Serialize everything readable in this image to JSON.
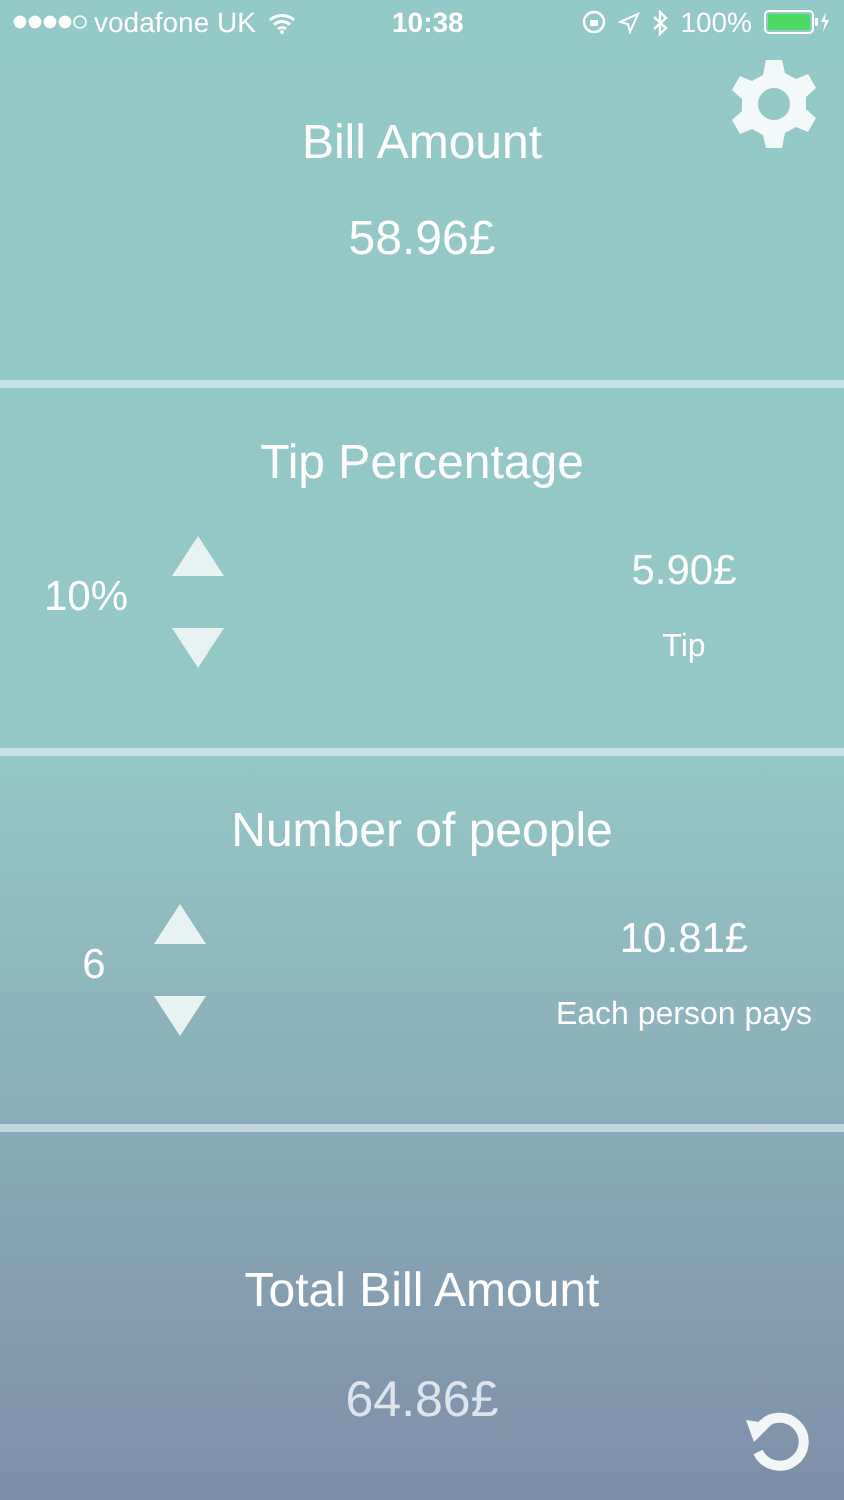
{
  "status_bar": {
    "carrier": "vodafone UK",
    "time": "10:38",
    "battery": "100%"
  },
  "bill": {
    "title": "Bill Amount",
    "amount": "58.96£"
  },
  "tip": {
    "title": "Tip Percentage",
    "percent": "10%",
    "amount": "5.90£",
    "caption": "Tip"
  },
  "people": {
    "title": "Number of people",
    "count": "6",
    "amount": "10.81£",
    "caption": "Each person pays"
  },
  "total": {
    "title": "Total Bill Amount",
    "amount": "64.86£"
  }
}
